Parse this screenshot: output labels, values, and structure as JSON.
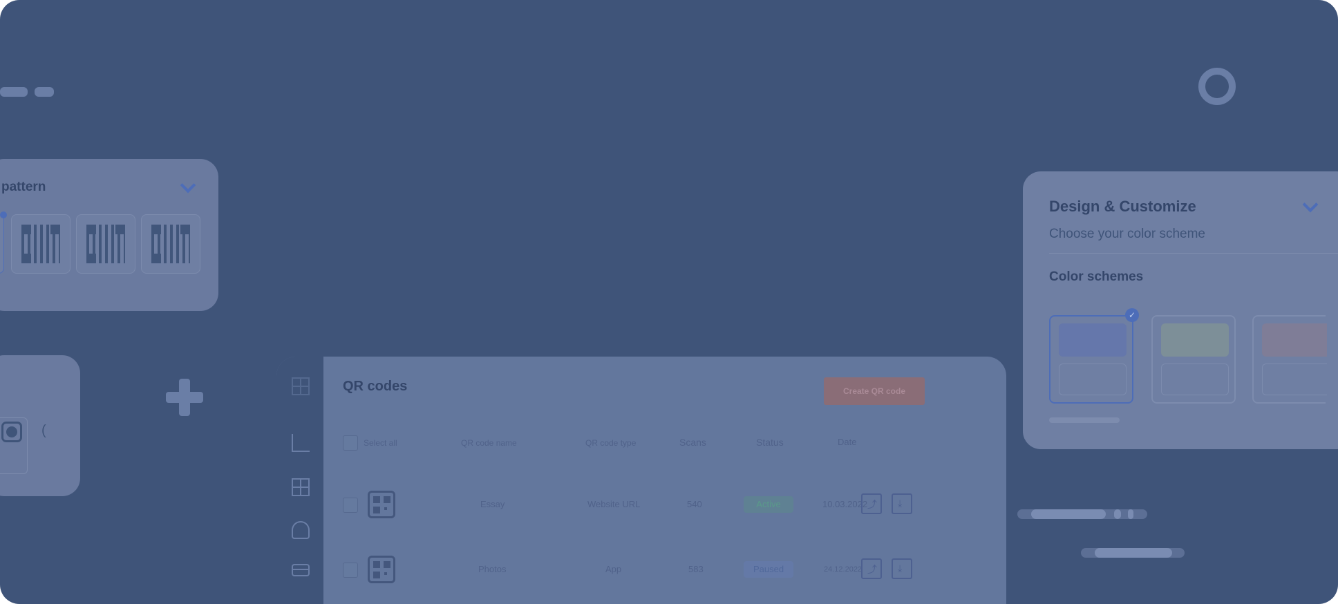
{
  "pattern_card": {
    "title": "pattern"
  },
  "social_card": {
    "paren": "("
  },
  "dashboard": {
    "title": "QR codes",
    "create_label": "Create QR code",
    "headers": {
      "select_all": "Select all",
      "name": "QR code name",
      "type": "QR code type",
      "scans": "Scans",
      "status": "Status",
      "date": "Date"
    },
    "rows": [
      {
        "name": "Essay",
        "type": "Website URL",
        "scans": "540",
        "status": "Active",
        "date": "10.03.2022"
      },
      {
        "name": "Photos",
        "type": "App",
        "scans": "583",
        "status": "Paused",
        "date": "24.12.2022"
      }
    ]
  },
  "design_card": {
    "title": "Design & Customize",
    "subtitle": "Choose your color scheme",
    "schemes_title": "Color schemes",
    "schemes": [
      {
        "swatch": "#6577ab",
        "selected": true
      },
      {
        "swatch": "#7d8f98",
        "selected": false
      },
      {
        "swatch": "#7f7d97",
        "selected": false
      }
    ],
    "check_glyph": "✓"
  },
  "icons": {
    "share": "⤴",
    "download": "⤓"
  }
}
